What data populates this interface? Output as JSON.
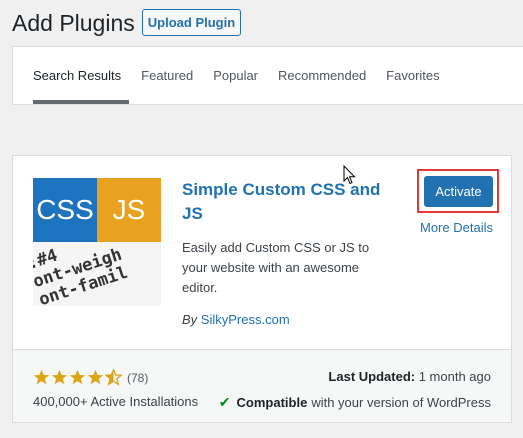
{
  "header": {
    "title": "Add Plugins",
    "upload_label": "Upload Plugin"
  },
  "tabs": [
    {
      "label": "Search Results",
      "active": true
    },
    {
      "label": "Featured"
    },
    {
      "label": "Popular"
    },
    {
      "label": "Recommended"
    },
    {
      "label": "Favorites"
    }
  ],
  "plugin": {
    "thumb": {
      "css_label": "CSS",
      "js_label": "JS",
      "code_line1": ":#4",
      "code_line2": "ont-weigh",
      "code_line3": "ont-famil"
    },
    "name": "Simple Custom CSS and JS",
    "description": "Easily add Custom CSS or JS to your website with an awesome editor.",
    "author_prefix": "By",
    "author": "SilkyPress.com",
    "activate_label": "Activate",
    "more_details_label": "More Details",
    "rating_value": 4.5,
    "rating_count": "(78)",
    "installs": "400,000+ Active Installations",
    "last_updated_label": "Last Updated:",
    "last_updated_value": "1 month ago",
    "compat_bold": "Compatible",
    "compat_text": "with your version of WordPress"
  },
  "colors": {
    "accent": "#2271b1",
    "star": "#dba617",
    "highlight": "#e53935",
    "check": "#008a20"
  },
  "icons": {
    "star": "star-icon",
    "check": "checkmark-icon",
    "cursor": "mouse-pointer-icon"
  }
}
